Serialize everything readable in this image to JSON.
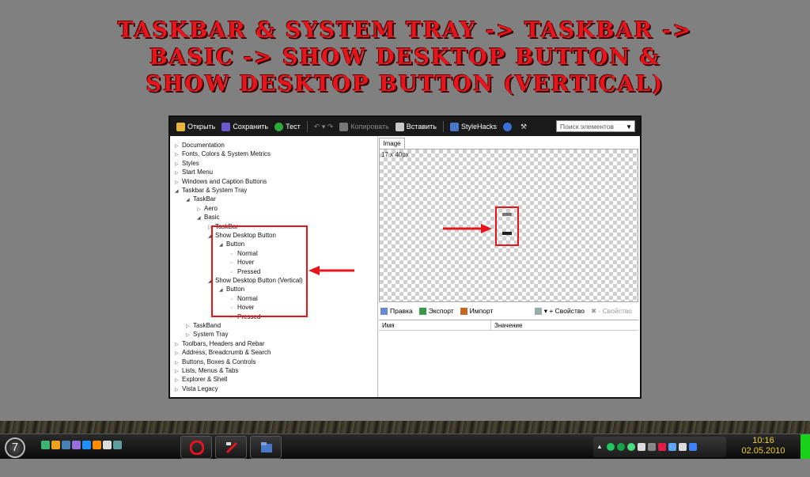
{
  "headline": [
    "TASKBAR & SYSTEM TRAY -> TASKBAR ->",
    "BASIC -> SHOW DESKTOP BUTTON &",
    "SHOW DESKTOP BUTTON (VERTICAL)"
  ],
  "toolbar": {
    "open": "Открыть",
    "save": "Сохранить",
    "test": "Тест",
    "copy": "Копировать",
    "paste": "Вставить",
    "stylehacks": "StyleHacks",
    "search_placeholder": "Поиск элементов"
  },
  "tree": [
    {
      "label": "Documentation",
      "level": 0,
      "tw": "▷"
    },
    {
      "label": "Fonts, Colors & System Metrics",
      "level": 0,
      "tw": "▷"
    },
    {
      "label": "Styles",
      "level": 0,
      "tw": "▷"
    },
    {
      "label": "Start Menu",
      "level": 0,
      "tw": "▷"
    },
    {
      "label": "Windows and Caption Buttons",
      "level": 0,
      "tw": "▷"
    },
    {
      "label": "Taskbar & System Tray",
      "level": 0,
      "tw": "◢"
    },
    {
      "label": "TaskBar",
      "level": 1,
      "tw": "◢"
    },
    {
      "label": "Aero",
      "level": 2,
      "tw": "▷"
    },
    {
      "label": "Basic",
      "level": 2,
      "tw": "◢"
    },
    {
      "label": "TaskBar",
      "level": 3,
      "tw": "▷"
    },
    {
      "label": "Show Desktop Button",
      "level": "3b",
      "tw": "◢"
    },
    {
      "label": "Button",
      "level": 4,
      "tw": "◢"
    },
    {
      "label": "Normal",
      "level": 5,
      "tw": ""
    },
    {
      "label": "Hover",
      "level": 5,
      "tw": ""
    },
    {
      "label": "Pressed",
      "level": 5,
      "tw": ""
    },
    {
      "label": "Show Desktop Button (Vertical)",
      "level": "3b",
      "tw": "◢"
    },
    {
      "label": "Button",
      "level": 4,
      "tw": "◢"
    },
    {
      "label": "Normal",
      "level": 5,
      "tw": ""
    },
    {
      "label": "Hover",
      "level": 5,
      "tw": ""
    },
    {
      "label": "Pressed",
      "level": 5,
      "tw": ""
    },
    {
      "label": "TaskBand",
      "level": 1,
      "tw": "▷"
    },
    {
      "label": "System Tray",
      "level": 1,
      "tw": "▷"
    },
    {
      "label": "Toolbars, Headers and Rebar",
      "level": 0,
      "tw": "▷"
    },
    {
      "label": "Address, Breadcrumb & Search",
      "level": 0,
      "tw": "▷"
    },
    {
      "label": "Buttons, Boxes & Controls",
      "level": 0,
      "tw": "▷"
    },
    {
      "label": "Lists, Menus & Tabs",
      "level": 0,
      "tw": "▷"
    },
    {
      "label": "Explorer & Shell",
      "level": 0,
      "tw": "▷"
    },
    {
      "label": "Vista Legacy",
      "level": 0,
      "tw": "▷"
    }
  ],
  "image_panel": {
    "tab": "Image",
    "size_text": "17 x 40px"
  },
  "props": {
    "edit": "Правка",
    "export": "Экспорт",
    "import": "Импорт",
    "property": "Свойство",
    "property_remove": "Свойство",
    "col_name": "Имя",
    "col_value": "Значение"
  },
  "taskbar": {
    "start_label": "7",
    "time": "10:16",
    "date": "02.05.2010"
  },
  "colors": {
    "accent_red": "#e8141c",
    "clock": "#f2d21c",
    "tray_green": "#19d119"
  }
}
